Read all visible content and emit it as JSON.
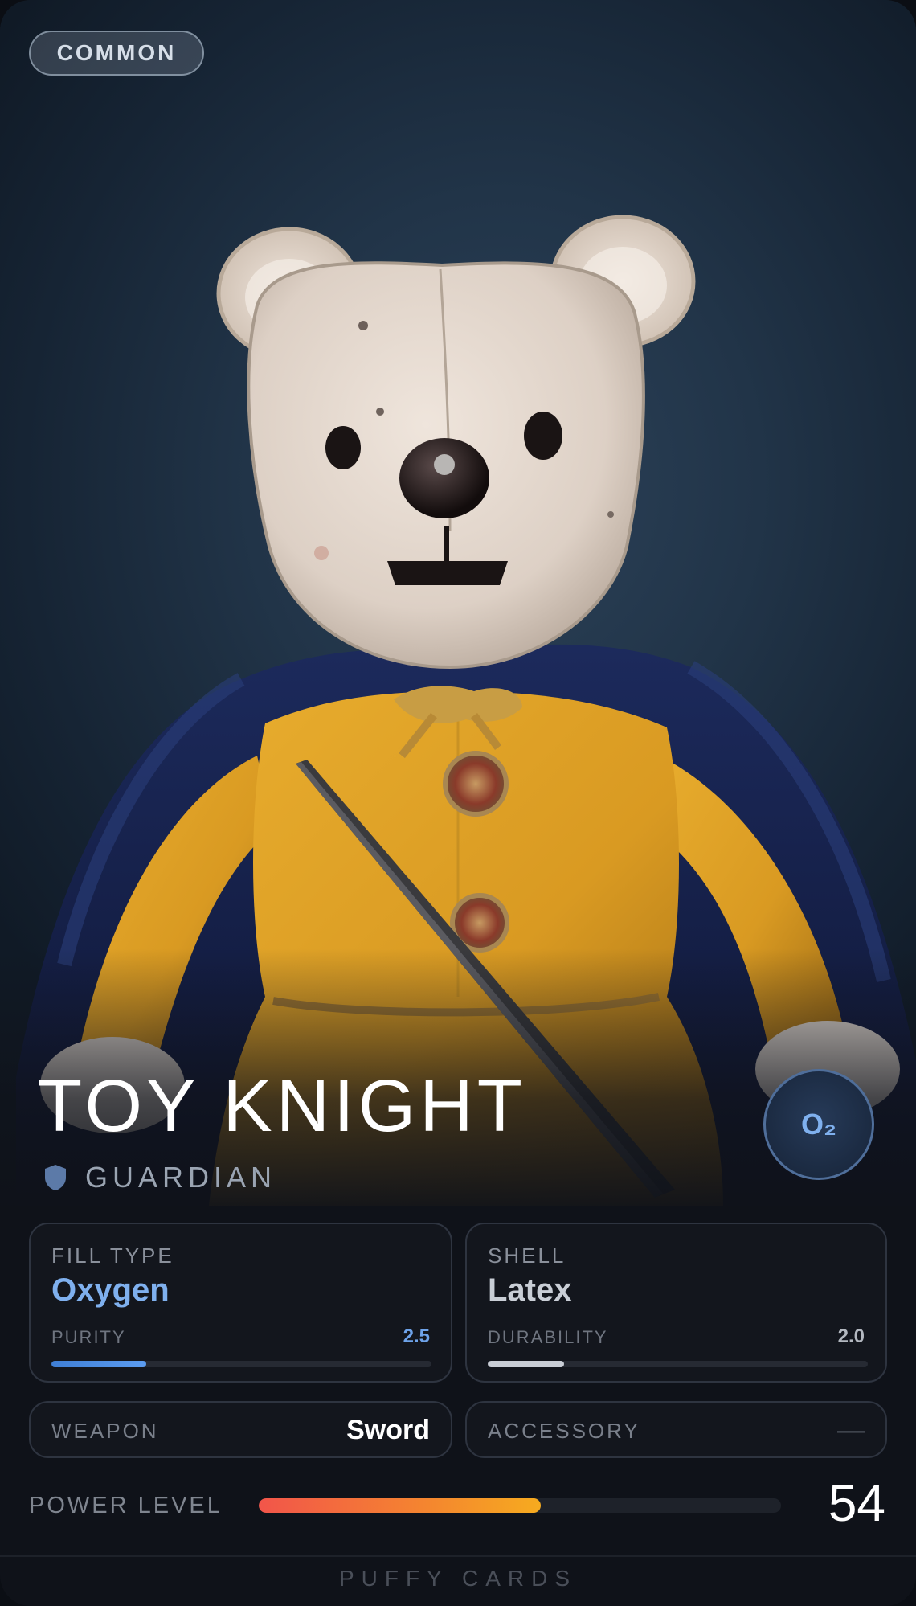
{
  "card": {
    "rarity": "COMMON",
    "name": "TOY KNIGHT",
    "class": "GUARDIAN",
    "class_icon": "shield-icon",
    "element_symbol": "O₂"
  },
  "stats": {
    "fill": {
      "label": "FILL TYPE",
      "value": "Oxygen",
      "sublabel": "PURITY",
      "subvalue": "2.5",
      "level": 0.25,
      "color": "#5b9cf0"
    },
    "shell": {
      "label": "SHELL",
      "value": "Latex",
      "sublabel": "DURABILITY",
      "subvalue": "2.0",
      "level": 0.2,
      "color": "#c9ced6"
    },
    "weapon": {
      "label": "WEAPON",
      "value": "Sword"
    },
    "accessory": {
      "label": "ACCESSORY",
      "value": "—"
    }
  },
  "power": {
    "label": "POWER LEVEL",
    "value": "54",
    "level": 0.54
  },
  "footer": "PUFFY CARDS",
  "colors": {
    "accent_blue": "#7fb0ee",
    "power_start": "#f2554a",
    "power_end": "#f6ab1f"
  }
}
